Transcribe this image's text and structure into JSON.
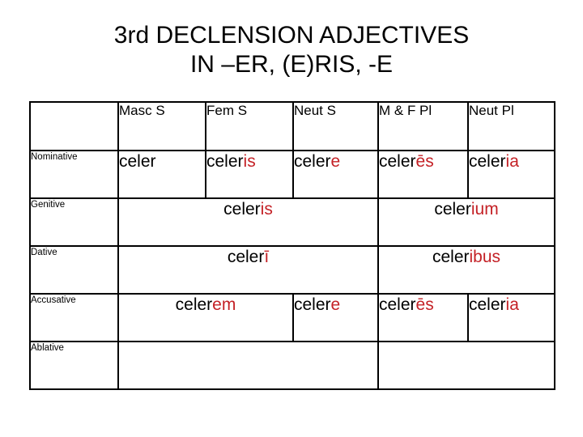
{
  "slide": {
    "title_lines": [
      "3rd DECLENSION ADJECTIVES",
      "IN –ER, (E)RIS, -E"
    ],
    "colors": {
      "stem": "#000000",
      "ending": "#C42126",
      "border": "#000000",
      "background": "#FFFFFF"
    }
  },
  "table": {
    "headers": {
      "corner": "",
      "masc_s": "Masc S",
      "fem_s": "Fem S",
      "neut_s": "Neut S",
      "mf_pl": "M & F Pl",
      "neut_pl": "Neut Pl"
    },
    "rows": {
      "nominative": {
        "label": "Nominative",
        "masc_s": {
          "stem": "celer",
          "ending": ""
        },
        "fem_s": {
          "stem": "celer",
          "ending": "is"
        },
        "neut_s": {
          "stem": "celer",
          "ending": "e"
        },
        "mf_pl": {
          "stem": "celer",
          "ending": "ēs"
        },
        "neut_pl": {
          "stem": "celer",
          "ending": "ia"
        }
      },
      "genitive": {
        "label": "Genitive",
        "singular": {
          "stem": "celer",
          "ending": "is"
        },
        "plural": {
          "stem": "celer",
          "ending": "ium"
        }
      },
      "dative": {
        "label": "Dative",
        "singular": {
          "stem": "celer",
          "ending": "ī"
        },
        "plural": {
          "stem": "celer",
          "ending": "ibus"
        }
      },
      "accusative": {
        "label": "Accusative",
        "masc_fem_s": {
          "stem": "celer",
          "ending": "em"
        },
        "neut_s": {
          "stem": "celer",
          "ending": "e"
        },
        "mf_pl": {
          "stem": "celer",
          "ending": "ēs"
        },
        "neut_pl": {
          "stem": "celer",
          "ending": "ia"
        }
      },
      "ablative": {
        "label": "Ablative",
        "singular": {
          "stem": "",
          "ending": ""
        },
        "plural": {
          "stem": "",
          "ending": ""
        }
      }
    }
  }
}
